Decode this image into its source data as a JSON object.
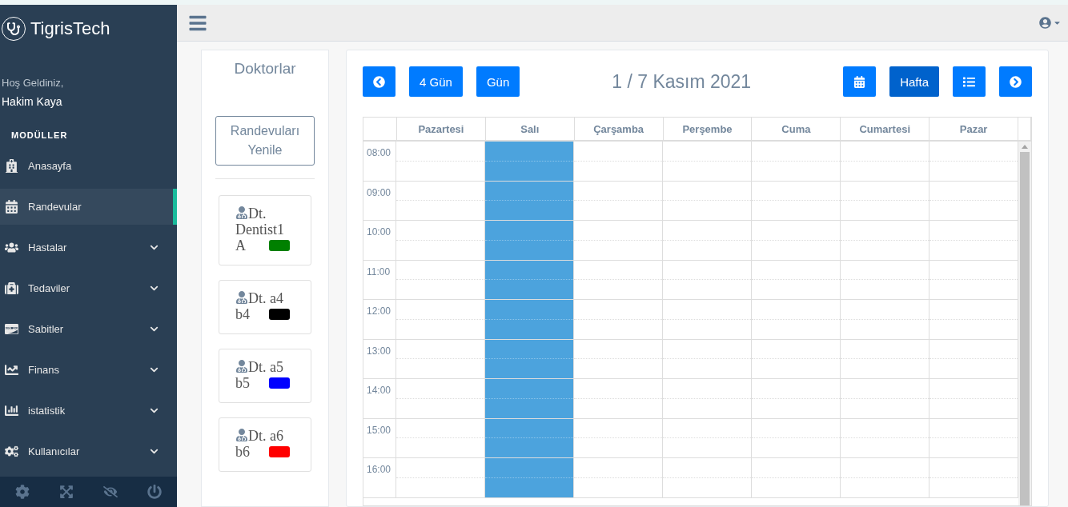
{
  "brand": "TigrisTech",
  "welcome": {
    "greeting": "Hoş Geldiniz,",
    "user": "Hakim Kaya"
  },
  "sidebar": {
    "section_title": "MODÜLLER",
    "items": [
      {
        "label": "Anasayfa",
        "selected": false,
        "expandable": false
      },
      {
        "label": "Randevular",
        "selected": true,
        "expandable": false
      },
      {
        "label": "Hastalar",
        "selected": false,
        "expandable": true
      },
      {
        "label": "Tedaviler",
        "selected": false,
        "expandable": true
      },
      {
        "label": "Sabitler",
        "selected": false,
        "expandable": true
      },
      {
        "label": "Finans",
        "selected": false,
        "expandable": true
      },
      {
        "label": "istatistik",
        "selected": false,
        "expandable": true
      },
      {
        "label": "Kullanıcılar",
        "selected": false,
        "expandable": true
      }
    ]
  },
  "doctors_panel": {
    "title": "Doktorlar",
    "refresh_button": "Randevuları Yenile",
    "doctors": [
      {
        "name": "Dt. Dentist1 A",
        "color": "#008000"
      },
      {
        "name": "Dt. a4 b4",
        "color": "#000000"
      },
      {
        "name": "Dt. a5 b5",
        "color": "#0000ff"
      },
      {
        "name": "Dt. a6 b6",
        "color": "#ff0000"
      }
    ]
  },
  "calendar": {
    "title": "1 / 7 Kasım 2021",
    "left_view_buttons": [
      {
        "kind": "text",
        "label": "4 Gün",
        "selected": false
      },
      {
        "kind": "text",
        "label": "Gün",
        "selected": false
      }
    ],
    "right_view_buttons": [
      {
        "kind": "month",
        "selected": false
      },
      {
        "kind": "text",
        "label": "Hafta",
        "selected": true
      },
      {
        "kind": "list",
        "selected": false
      }
    ],
    "days": [
      {
        "label": "Pazartesi",
        "highlighted": false
      },
      {
        "label": "Salı",
        "highlighted": true
      },
      {
        "label": "Çarşamba",
        "highlighted": false
      },
      {
        "label": "Perşembe",
        "highlighted": false
      },
      {
        "label": "Cuma",
        "highlighted": false
      },
      {
        "label": "Cumartesi",
        "highlighted": false
      },
      {
        "label": "Pazar",
        "highlighted": false
      }
    ],
    "hours": [
      "08:00",
      "09:00",
      "10:00",
      "11:00",
      "12:00",
      "13:00",
      "14:00",
      "15:00",
      "16:00"
    ]
  }
}
